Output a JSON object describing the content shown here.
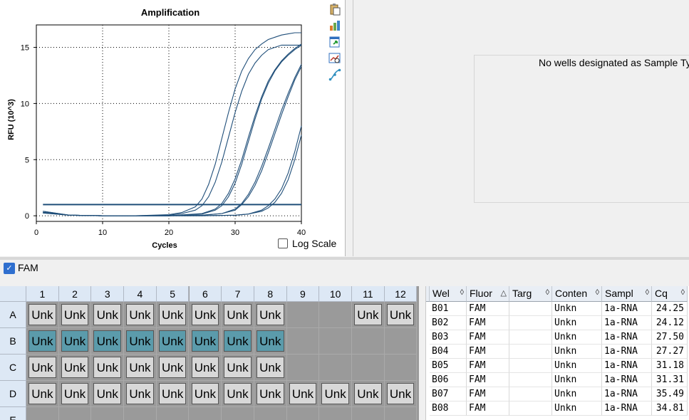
{
  "chart": {
    "icons": [
      "copy-icon",
      "export-icon",
      "refresh-icon",
      "zoom-chart-icon",
      "curve-settings-icon"
    ],
    "log_scale_label": "Log Scale"
  },
  "chart_data": {
    "type": "line",
    "title": "Amplification",
    "xlabel": "Cycles",
    "ylabel": "RFU (10^3)",
    "xlim": [
      0,
      40
    ],
    "ylim": [
      -0.5,
      17
    ],
    "xticks": [
      0,
      10,
      20,
      30,
      40
    ],
    "yticks": [
      0,
      5,
      10,
      15
    ],
    "grid": true,
    "threshold": 1.0,
    "series": [
      {
        "x": [
          1,
          5,
          10,
          15,
          20,
          22,
          24,
          25,
          26,
          27,
          28,
          29,
          30,
          31,
          32,
          33,
          34,
          35,
          36,
          37,
          38,
          39,
          40
        ],
        "y": [
          0.3,
          0.05,
          0,
          0,
          0.1,
          0.3,
          0.8,
          1.5,
          2.8,
          4.6,
          6.9,
          9.2,
          11.3,
          12.9,
          14.0,
          14.8,
          15.3,
          15.7,
          15.9,
          16.1,
          16.2,
          16.3,
          16.3
        ]
      },
      {
        "x": [
          1,
          5,
          10,
          15,
          20,
          22,
          24,
          25,
          26,
          27,
          28,
          29,
          30,
          31,
          32,
          33,
          34,
          35,
          36,
          37,
          38,
          39,
          40
        ],
        "y": [
          0.3,
          0.05,
          0,
          0,
          0.05,
          0.2,
          0.5,
          0.9,
          1.7,
          3.0,
          4.8,
          7.0,
          9.2,
          11.1,
          12.6,
          13.6,
          14.3,
          14.8,
          15.0,
          15.2,
          15.2,
          15.2,
          15.2
        ]
      },
      {
        "x": [
          1,
          5,
          10,
          15,
          20,
          25,
          27,
          28,
          29,
          30,
          31,
          32,
          33,
          34,
          35,
          36,
          37,
          38,
          39,
          40
        ],
        "y": [
          0.4,
          0.05,
          0,
          0,
          0,
          0.2,
          0.6,
          1.1,
          2.0,
          3.3,
          5.0,
          7.0,
          8.9,
          10.6,
          12.0,
          13.0,
          13.8,
          14.4,
          14.9,
          15.3
        ]
      },
      {
        "x": [
          1,
          5,
          10,
          15,
          20,
          25,
          27,
          28,
          29,
          30,
          31,
          32,
          33,
          34,
          35,
          36,
          37,
          38,
          39,
          40
        ],
        "y": [
          0.4,
          0.05,
          0,
          0,
          0,
          0.15,
          0.5,
          0.9,
          1.7,
          2.9,
          4.6,
          6.6,
          8.6,
          10.4,
          11.8,
          12.9,
          13.7,
          14.3,
          14.8,
          15.2
        ]
      },
      {
        "x": [
          1,
          5,
          10,
          15,
          20,
          25,
          28,
          30,
          31,
          32,
          33,
          34,
          35,
          36,
          37,
          38,
          39,
          40
        ],
        "y": [
          0.3,
          0.05,
          0,
          0,
          0,
          0.05,
          0.2,
          0.6,
          1.1,
          1.9,
          3.0,
          4.4,
          6.0,
          7.7,
          9.4,
          10.9,
          12.3,
          13.5
        ]
      },
      {
        "x": [
          1,
          5,
          10,
          15,
          20,
          25,
          28,
          30,
          31,
          32,
          33,
          34,
          35,
          36,
          37,
          38,
          39,
          40
        ],
        "y": [
          0.3,
          0.05,
          0,
          0,
          0,
          0.05,
          0.2,
          0.5,
          1.0,
          1.7,
          2.7,
          4.0,
          5.6,
          7.3,
          9.0,
          10.6,
          12.1,
          13.3
        ]
      },
      {
        "x": [
          1,
          5,
          10,
          15,
          20,
          25,
          30,
          32,
          34,
          35,
          36,
          37,
          38,
          39,
          40
        ],
        "y": [
          0.25,
          0.05,
          0,
          0,
          0,
          0,
          0.05,
          0.15,
          0.4,
          0.7,
          1.2,
          2.0,
          3.2,
          5.0,
          7.2
        ]
      },
      {
        "x": [
          1,
          5,
          10,
          15,
          20,
          25,
          30,
          32,
          34,
          35,
          36,
          37,
          38,
          39,
          40
        ],
        "y": [
          0.25,
          0.05,
          0,
          0,
          0,
          0,
          0.05,
          0.15,
          0.5,
          0.9,
          1.5,
          2.4,
          3.8,
          5.7,
          8.0
        ]
      }
    ]
  },
  "right_panel": {
    "message": "No wells designated as Sample Ty"
  },
  "fluor": {
    "label": "FAM"
  },
  "plate": {
    "columns": [
      "1",
      "2",
      "3",
      "4",
      "5",
      "6",
      "7",
      "8",
      "9",
      "10",
      "11",
      "12"
    ],
    "rows": [
      "A",
      "B",
      "C",
      "D",
      "E"
    ],
    "wells": [
      [
        "Unk",
        "Unk",
        "Unk",
        "Unk",
        "Unk",
        "Unk",
        "Unk",
        "Unk",
        "",
        "",
        "Unk",
        "Unk"
      ],
      [
        "Unk",
        "Unk",
        "Unk",
        "Unk",
        "Unk",
        "Unk",
        "Unk",
        "Unk",
        "",
        "",
        "",
        ""
      ],
      [
        "Unk",
        "Unk",
        "Unk",
        "Unk",
        "Unk",
        "Unk",
        "Unk",
        "Unk",
        "",
        "",
        "",
        ""
      ],
      [
        "Unk",
        "Unk",
        "Unk",
        "Unk",
        "Unk",
        "Unk",
        "Unk",
        "Unk",
        "Unk",
        "Unk",
        "Unk",
        "Unk"
      ],
      [
        "",
        "",
        "",
        "",
        "",
        "",
        "",
        "",
        "",
        "",
        "",
        ""
      ]
    ],
    "selected_row": "B"
  },
  "table": {
    "headers": [
      "Wel",
      "Fluor",
      "Targ",
      "Conten",
      "Sampl",
      "Cq"
    ],
    "rows": [
      [
        "B01",
        "FAM",
        "",
        "Unkn",
        "1a-RNA",
        "24.25"
      ],
      [
        "B02",
        "FAM",
        "",
        "Unkn",
        "1a-RNA",
        "24.12"
      ],
      [
        "B03",
        "FAM",
        "",
        "Unkn",
        "1a-RNA",
        "27.50"
      ],
      [
        "B04",
        "FAM",
        "",
        "Unkn",
        "1a-RNA",
        "27.27"
      ],
      [
        "B05",
        "FAM",
        "",
        "Unkn",
        "1a-RNA",
        "31.18"
      ],
      [
        "B06",
        "FAM",
        "",
        "Unkn",
        "1a-RNA",
        "31.31"
      ],
      [
        "B07",
        "FAM",
        "",
        "Unkn",
        "1a-RNA",
        "35.49"
      ],
      [
        "B08",
        "FAM",
        "",
        "Unkn",
        "1a-RNA",
        "34.81"
      ]
    ]
  },
  "colors": {
    "curve": "#1f4e79",
    "selected_well": "#5b9bab",
    "well": "#d8d8d8",
    "empty_well": "#9a9a9a"
  }
}
